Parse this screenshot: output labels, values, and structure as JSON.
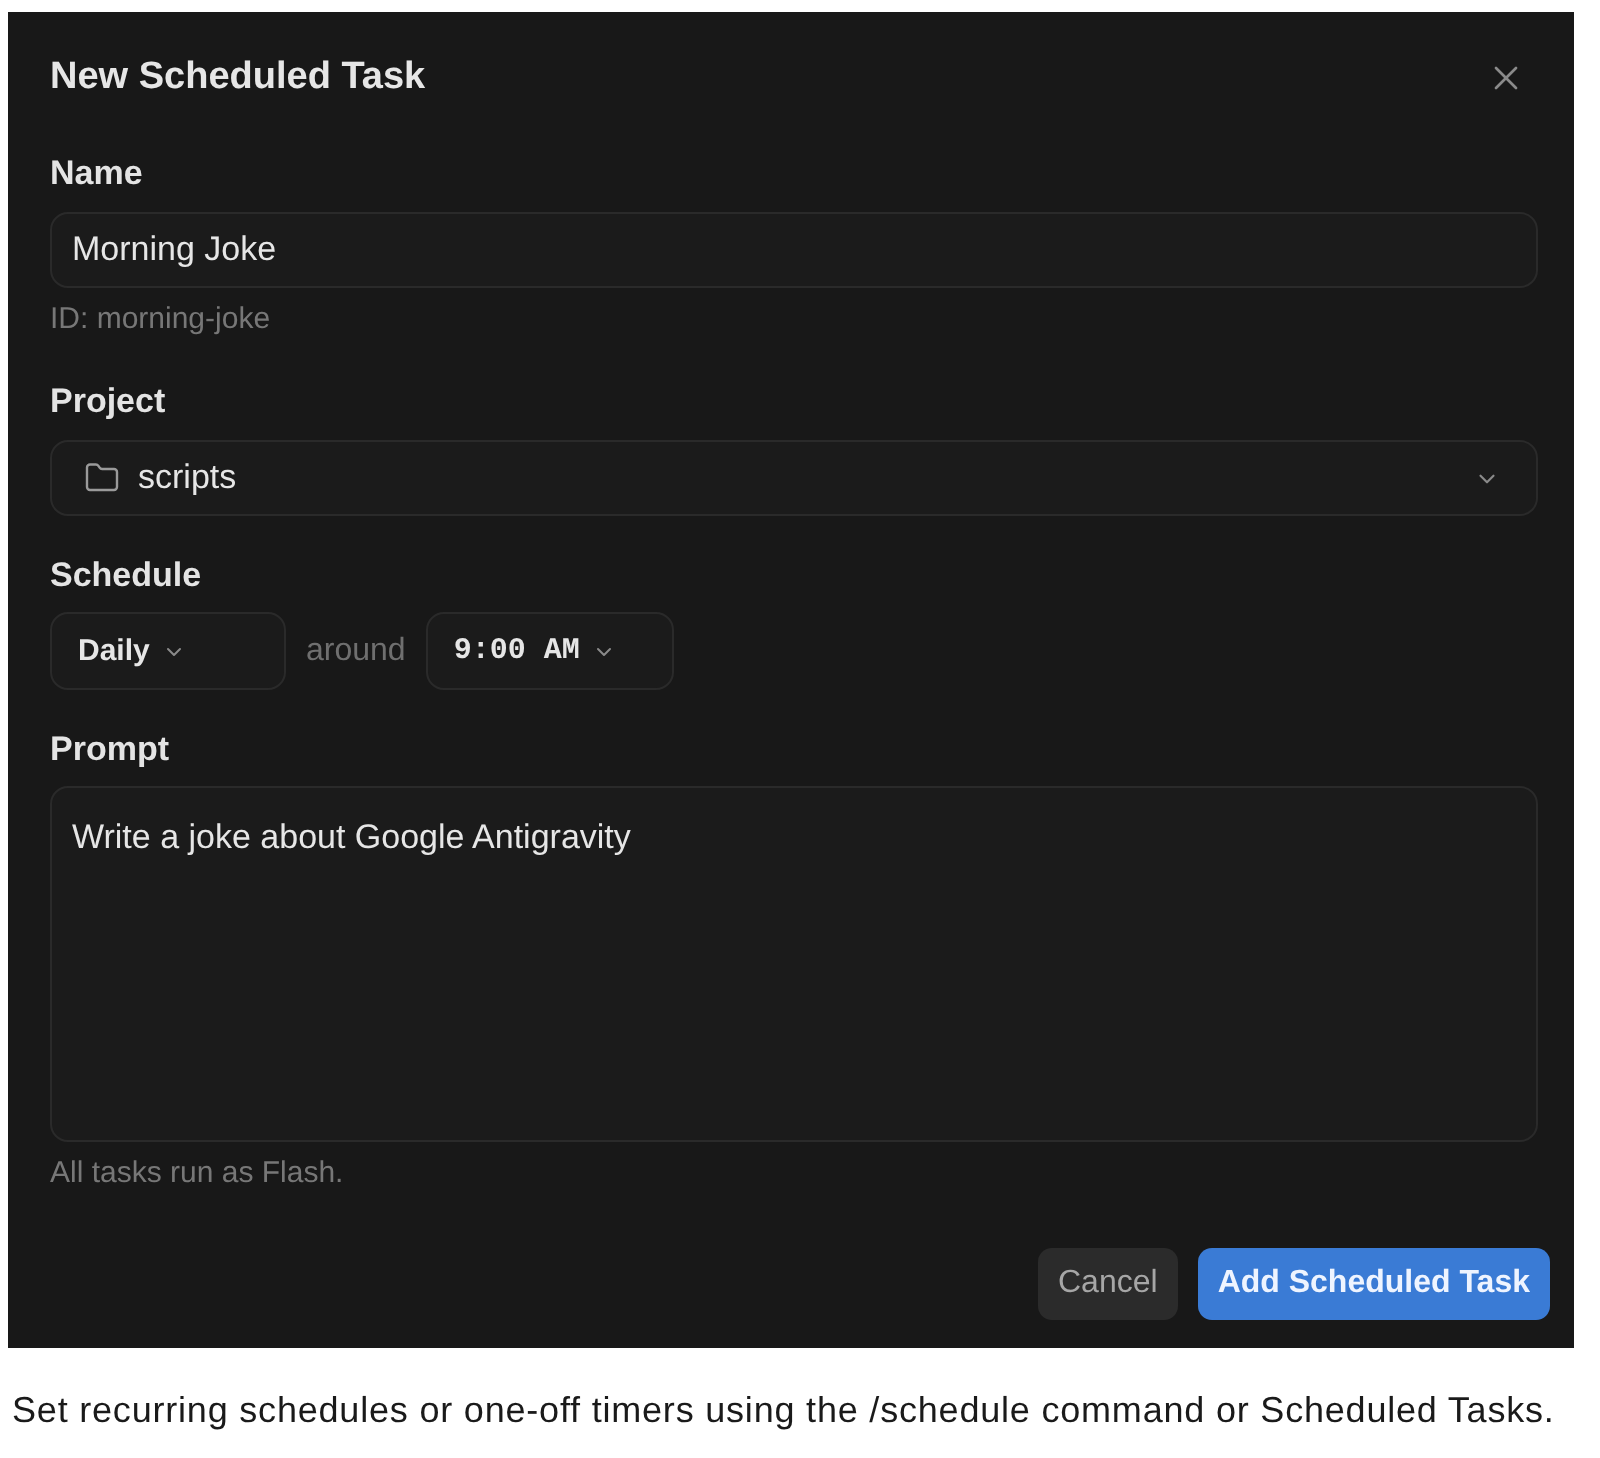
{
  "dialog": {
    "title": "New Scheduled Task",
    "name": {
      "label": "Name",
      "value": "Morning Joke",
      "hint": "ID: morning-joke"
    },
    "project": {
      "label": "Project",
      "value": "scripts"
    },
    "schedule": {
      "label": "Schedule",
      "frequency": "Daily",
      "connector": "around",
      "time": "9:00 AM"
    },
    "prompt": {
      "label": "Prompt",
      "value": "Write a joke about Google Antigravity",
      "hint": "All tasks run as Flash."
    },
    "buttons": [
      {
        "label": "Cancel",
        "kind": "secondary"
      },
      {
        "label": "Add Scheduled Task",
        "kind": "primary"
      }
    ]
  },
  "caption": "Set recurring schedules or one-off timers using the /schedule command or Scheduled Tasks."
}
